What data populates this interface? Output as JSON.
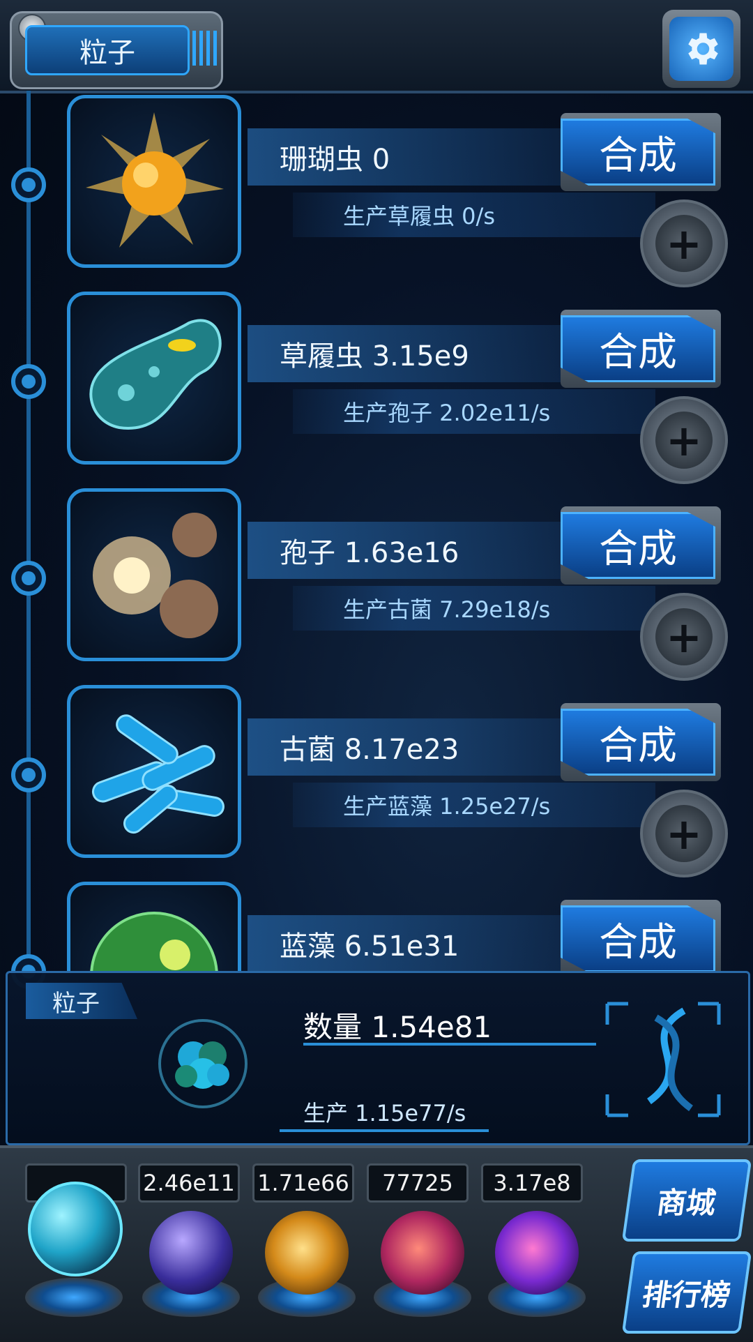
{
  "header": {
    "tab_label": "粒子"
  },
  "creatures": [
    {
      "name_text": "珊瑚虫 0",
      "produce_text": "生产草履虫 0/s",
      "synth_label": "合成"
    },
    {
      "name_text": "草履虫 3.15e9",
      "produce_text": "生产孢子 2.02e11/s",
      "synth_label": "合成"
    },
    {
      "name_text": "孢子 1.63e16",
      "produce_text": "生产古菌 7.29e18/s",
      "synth_label": "合成"
    },
    {
      "name_text": "古菌 8.17e23",
      "produce_text": "生产蓝藻 1.25e27/s",
      "synth_label": "合成"
    },
    {
      "name_text": "蓝藻 6.51e31",
      "synth_label": "合成"
    }
  ],
  "panel": {
    "tag": "粒子",
    "quantity": "数量 1.54e81",
    "production": "生产 1.15e77/s"
  },
  "dock": {
    "counters": [
      "2.46e11",
      "1.71e66",
      "77725",
      "3.17e8"
    ],
    "shop_label": "商城",
    "ranking_label": "排行榜"
  },
  "colors": {
    "accent": "#2a8fd8",
    "button_blue": "#1f7be0",
    "background": "#071226"
  }
}
